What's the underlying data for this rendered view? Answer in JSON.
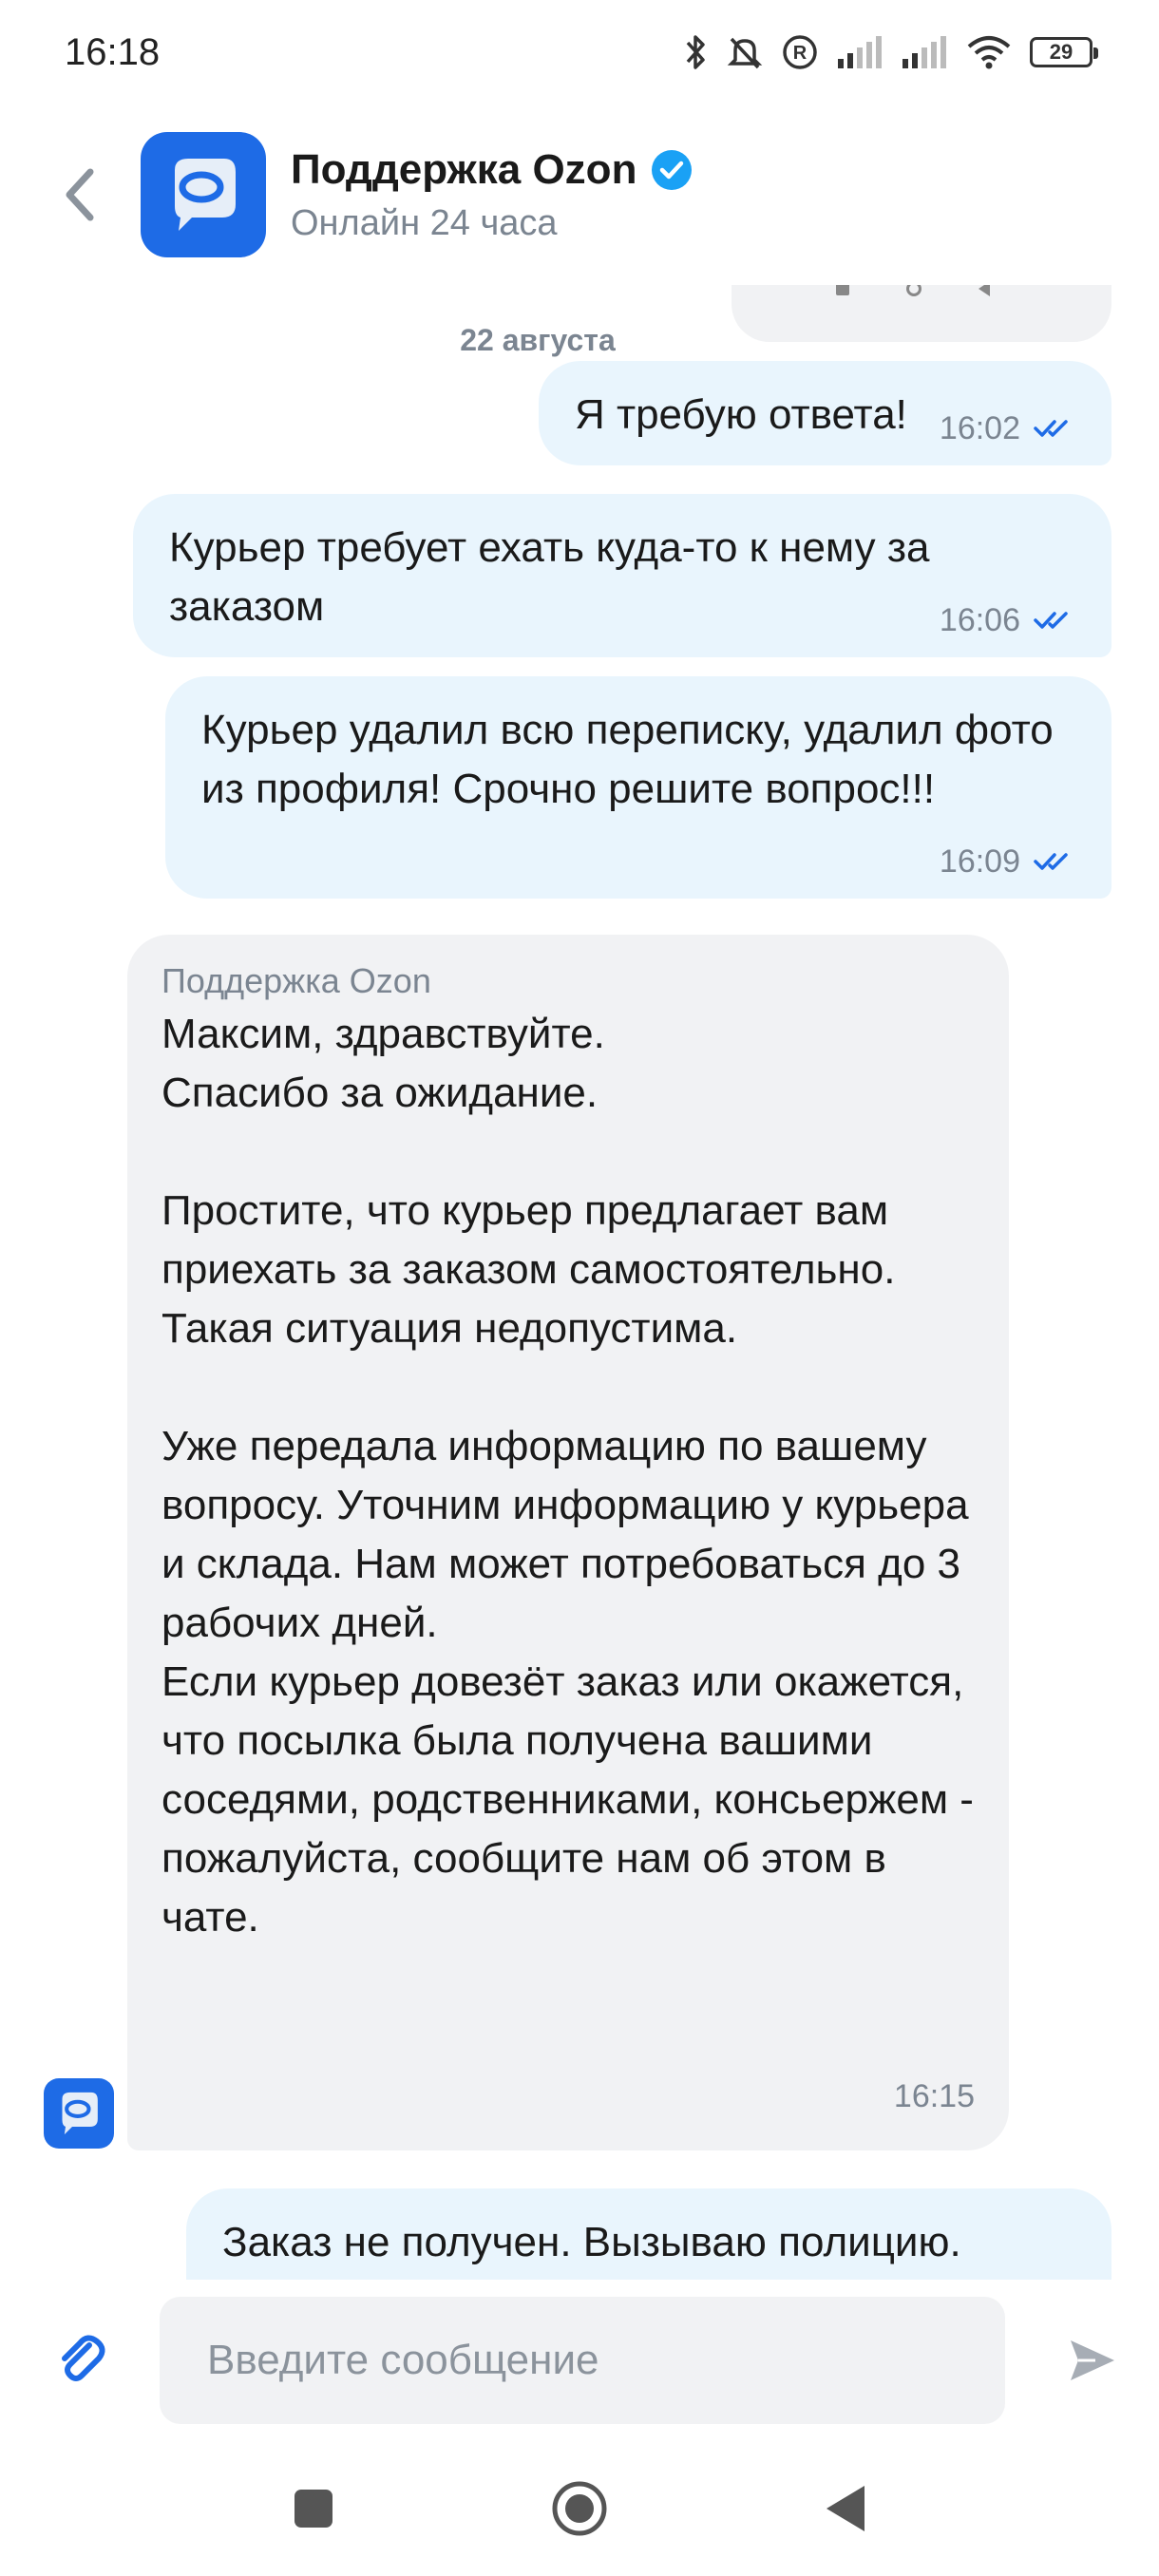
{
  "status_bar": {
    "time": "16:18",
    "battery": "29",
    "icons": [
      "bluetooth-icon",
      "mute-icon",
      "registered-icon",
      "signal-icon",
      "signal-icon",
      "wifi-icon",
      "battery-icon"
    ]
  },
  "header": {
    "title": "Поддержка Ozon",
    "subtitle": "Онлайн 24 часа",
    "verified_icon": "verified-badge-icon",
    "back_icon": "chevron-left-icon"
  },
  "chat": {
    "date_label": "22 августа",
    "messages": [
      {
        "direction": "out",
        "text": "Я требую ответа!",
        "time": "16:02",
        "status_icon": "double-check-icon"
      },
      {
        "direction": "out",
        "text": "Курьер требует ехать куда-то к нему за заказом",
        "time": "16:06",
        "status_icon": "double-check-icon"
      },
      {
        "direction": "out",
        "text": "Курьер удалил всю переписку, удалил фото из профиля! Срочно решите вопрос!!!",
        "time": "16:09",
        "status_icon": "double-check-icon"
      },
      {
        "direction": "in",
        "sender": "Поддержка Ozon",
        "text": "Максим, здравствуйте.\nСпасибо за ожидание.\n\nПростите, что курьер предлагает вам приехать за заказом самостоятельно. Такая ситуация недопустима.\n\nУже передала информацию по вашему вопросу. Уточним информацию у курьера и склада. Нам может потребоваться до 3 рабочих дней.\nЕсли курьер довезёт заказ или окажется, что посылка была получена вашими соседями, родственниками, консьержем - пожалуйста, сообщите нам об этом в чате.",
        "time": "16:15"
      },
      {
        "direction": "out",
        "text": "Заказ не получен. Вызываю полицию."
      }
    ]
  },
  "composer": {
    "placeholder": "Введите сообщение",
    "attach_icon": "paperclip-icon",
    "send_icon": "send-icon"
  },
  "colors": {
    "accent": "#1e6be6",
    "outgoing_bubble": "#e9f5fd",
    "incoming_bubble": "#f1f2f4",
    "muted_text": "#7b8591",
    "check": "#1e6be6"
  }
}
